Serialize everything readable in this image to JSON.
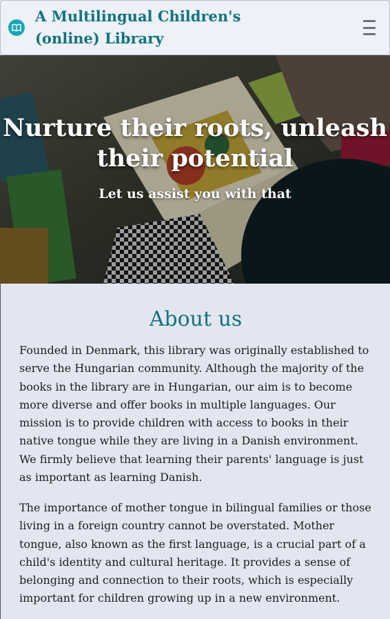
{
  "navbar": {
    "brand": "A Multilingual Children's (online) Library",
    "logo_icon": "open-book-icon",
    "menu_icon": "hamburger-menu-icon"
  },
  "hero": {
    "title": "Nurture their roots, unleash their potential",
    "subtitle": "Let us assist you with that"
  },
  "about": {
    "heading": "About us",
    "paragraphs": [
      "Founded in Denmark, this library was originally established to serve the Hungarian community. Although the majority of the books in the library are in Hungarian, our aim is to become more diverse and offer books in multiple languages. Our mission is to provide children with access to books in their native tongue while they are living in a Danish environment. We firmly believe that learning their parents' language is just as important as learning Danish.",
      "The importance of mother tongue in bilingual families or those living in a foreign country cannot be overstated. Mother tongue, also known as the first language, is a crucial part of a child's identity and cultural heritage. It provides a sense of belonging and connection to their roots, which is especially important for children growing up in a new environment."
    ]
  },
  "colors": {
    "brand": "#137380",
    "page_background": "#e3e6f0",
    "navbar_background": "#eef1f7",
    "logo_circle": "#1aa6b8"
  }
}
